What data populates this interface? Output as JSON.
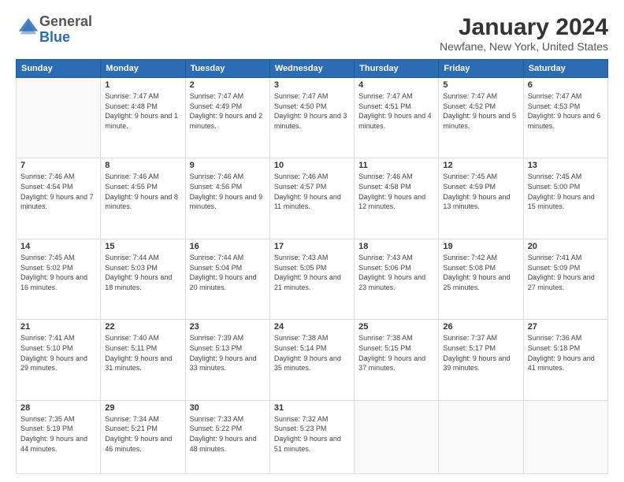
{
  "logo": {
    "general": "General",
    "blue": "Blue"
  },
  "title": "January 2024",
  "subtitle": "Newfane, New York, United States",
  "days_header": [
    "Sunday",
    "Monday",
    "Tuesday",
    "Wednesday",
    "Thursday",
    "Friday",
    "Saturday"
  ],
  "weeks": [
    [
      {
        "day": "",
        "sunrise": "",
        "sunset": "",
        "daylight": "",
        "empty": true
      },
      {
        "day": "1",
        "sunrise": "Sunrise: 7:47 AM",
        "sunset": "Sunset: 4:48 PM",
        "daylight": "Daylight: 9 hours and 1 minute."
      },
      {
        "day": "2",
        "sunrise": "Sunrise: 7:47 AM",
        "sunset": "Sunset: 4:49 PM",
        "daylight": "Daylight: 9 hours and 2 minutes."
      },
      {
        "day": "3",
        "sunrise": "Sunrise: 7:47 AM",
        "sunset": "Sunset: 4:50 PM",
        "daylight": "Daylight: 9 hours and 3 minutes."
      },
      {
        "day": "4",
        "sunrise": "Sunrise: 7:47 AM",
        "sunset": "Sunset: 4:51 PM",
        "daylight": "Daylight: 9 hours and 4 minutes."
      },
      {
        "day": "5",
        "sunrise": "Sunrise: 7:47 AM",
        "sunset": "Sunset: 4:52 PM",
        "daylight": "Daylight: 9 hours and 5 minutes."
      },
      {
        "day": "6",
        "sunrise": "Sunrise: 7:47 AM",
        "sunset": "Sunset: 4:53 PM",
        "daylight": "Daylight: 9 hours and 6 minutes."
      }
    ],
    [
      {
        "day": "7",
        "sunrise": "Sunrise: 7:46 AM",
        "sunset": "Sunset: 4:54 PM",
        "daylight": "Daylight: 9 hours and 7 minutes."
      },
      {
        "day": "8",
        "sunrise": "Sunrise: 7:46 AM",
        "sunset": "Sunset: 4:55 PM",
        "daylight": "Daylight: 9 hours and 8 minutes."
      },
      {
        "day": "9",
        "sunrise": "Sunrise: 7:46 AM",
        "sunset": "Sunset: 4:56 PM",
        "daylight": "Daylight: 9 hours and 9 minutes."
      },
      {
        "day": "10",
        "sunrise": "Sunrise: 7:46 AM",
        "sunset": "Sunset: 4:57 PM",
        "daylight": "Daylight: 9 hours and 11 minutes."
      },
      {
        "day": "11",
        "sunrise": "Sunrise: 7:46 AM",
        "sunset": "Sunset: 4:58 PM",
        "daylight": "Daylight: 9 hours and 12 minutes."
      },
      {
        "day": "12",
        "sunrise": "Sunrise: 7:45 AM",
        "sunset": "Sunset: 4:59 PM",
        "daylight": "Daylight: 9 hours and 13 minutes."
      },
      {
        "day": "13",
        "sunrise": "Sunrise: 7:45 AM",
        "sunset": "Sunset: 5:00 PM",
        "daylight": "Daylight: 9 hours and 15 minutes."
      }
    ],
    [
      {
        "day": "14",
        "sunrise": "Sunrise: 7:45 AM",
        "sunset": "Sunset: 5:02 PM",
        "daylight": "Daylight: 9 hours and 16 minutes."
      },
      {
        "day": "15",
        "sunrise": "Sunrise: 7:44 AM",
        "sunset": "Sunset: 5:03 PM",
        "daylight": "Daylight: 9 hours and 18 minutes."
      },
      {
        "day": "16",
        "sunrise": "Sunrise: 7:44 AM",
        "sunset": "Sunset: 5:04 PM",
        "daylight": "Daylight: 9 hours and 20 minutes."
      },
      {
        "day": "17",
        "sunrise": "Sunrise: 7:43 AM",
        "sunset": "Sunset: 5:05 PM",
        "daylight": "Daylight: 9 hours and 21 minutes."
      },
      {
        "day": "18",
        "sunrise": "Sunrise: 7:43 AM",
        "sunset": "Sunset: 5:06 PM",
        "daylight": "Daylight: 9 hours and 23 minutes."
      },
      {
        "day": "19",
        "sunrise": "Sunrise: 7:42 AM",
        "sunset": "Sunset: 5:08 PM",
        "daylight": "Daylight: 9 hours and 25 minutes."
      },
      {
        "day": "20",
        "sunrise": "Sunrise: 7:41 AM",
        "sunset": "Sunset: 5:09 PM",
        "daylight": "Daylight: 9 hours and 27 minutes."
      }
    ],
    [
      {
        "day": "21",
        "sunrise": "Sunrise: 7:41 AM",
        "sunset": "Sunset: 5:10 PM",
        "daylight": "Daylight: 9 hours and 29 minutes."
      },
      {
        "day": "22",
        "sunrise": "Sunrise: 7:40 AM",
        "sunset": "Sunset: 5:11 PM",
        "daylight": "Daylight: 9 hours and 31 minutes."
      },
      {
        "day": "23",
        "sunrise": "Sunrise: 7:39 AM",
        "sunset": "Sunset: 5:13 PM",
        "daylight": "Daylight: 9 hours and 33 minutes."
      },
      {
        "day": "24",
        "sunrise": "Sunrise: 7:38 AM",
        "sunset": "Sunset: 5:14 PM",
        "daylight": "Daylight: 9 hours and 35 minutes."
      },
      {
        "day": "25",
        "sunrise": "Sunrise: 7:38 AM",
        "sunset": "Sunset: 5:15 PM",
        "daylight": "Daylight: 9 hours and 37 minutes."
      },
      {
        "day": "26",
        "sunrise": "Sunrise: 7:37 AM",
        "sunset": "Sunset: 5:17 PM",
        "daylight": "Daylight: 9 hours and 39 minutes."
      },
      {
        "day": "27",
        "sunrise": "Sunrise: 7:36 AM",
        "sunset": "Sunset: 5:18 PM",
        "daylight": "Daylight: 9 hours and 41 minutes."
      }
    ],
    [
      {
        "day": "28",
        "sunrise": "Sunrise: 7:35 AM",
        "sunset": "Sunset: 5:19 PM",
        "daylight": "Daylight: 9 hours and 44 minutes."
      },
      {
        "day": "29",
        "sunrise": "Sunrise: 7:34 AM",
        "sunset": "Sunset: 5:21 PM",
        "daylight": "Daylight: 9 hours and 46 minutes."
      },
      {
        "day": "30",
        "sunrise": "Sunrise: 7:33 AM",
        "sunset": "Sunset: 5:22 PM",
        "daylight": "Daylight: 9 hours and 48 minutes."
      },
      {
        "day": "31",
        "sunrise": "Sunrise: 7:32 AM",
        "sunset": "Sunset: 5:23 PM",
        "daylight": "Daylight: 9 hours and 51 minutes."
      },
      {
        "day": "",
        "sunrise": "",
        "sunset": "",
        "daylight": "",
        "empty": true
      },
      {
        "day": "",
        "sunrise": "",
        "sunset": "",
        "daylight": "",
        "empty": true
      },
      {
        "day": "",
        "sunrise": "",
        "sunset": "",
        "daylight": "",
        "empty": true
      }
    ]
  ]
}
